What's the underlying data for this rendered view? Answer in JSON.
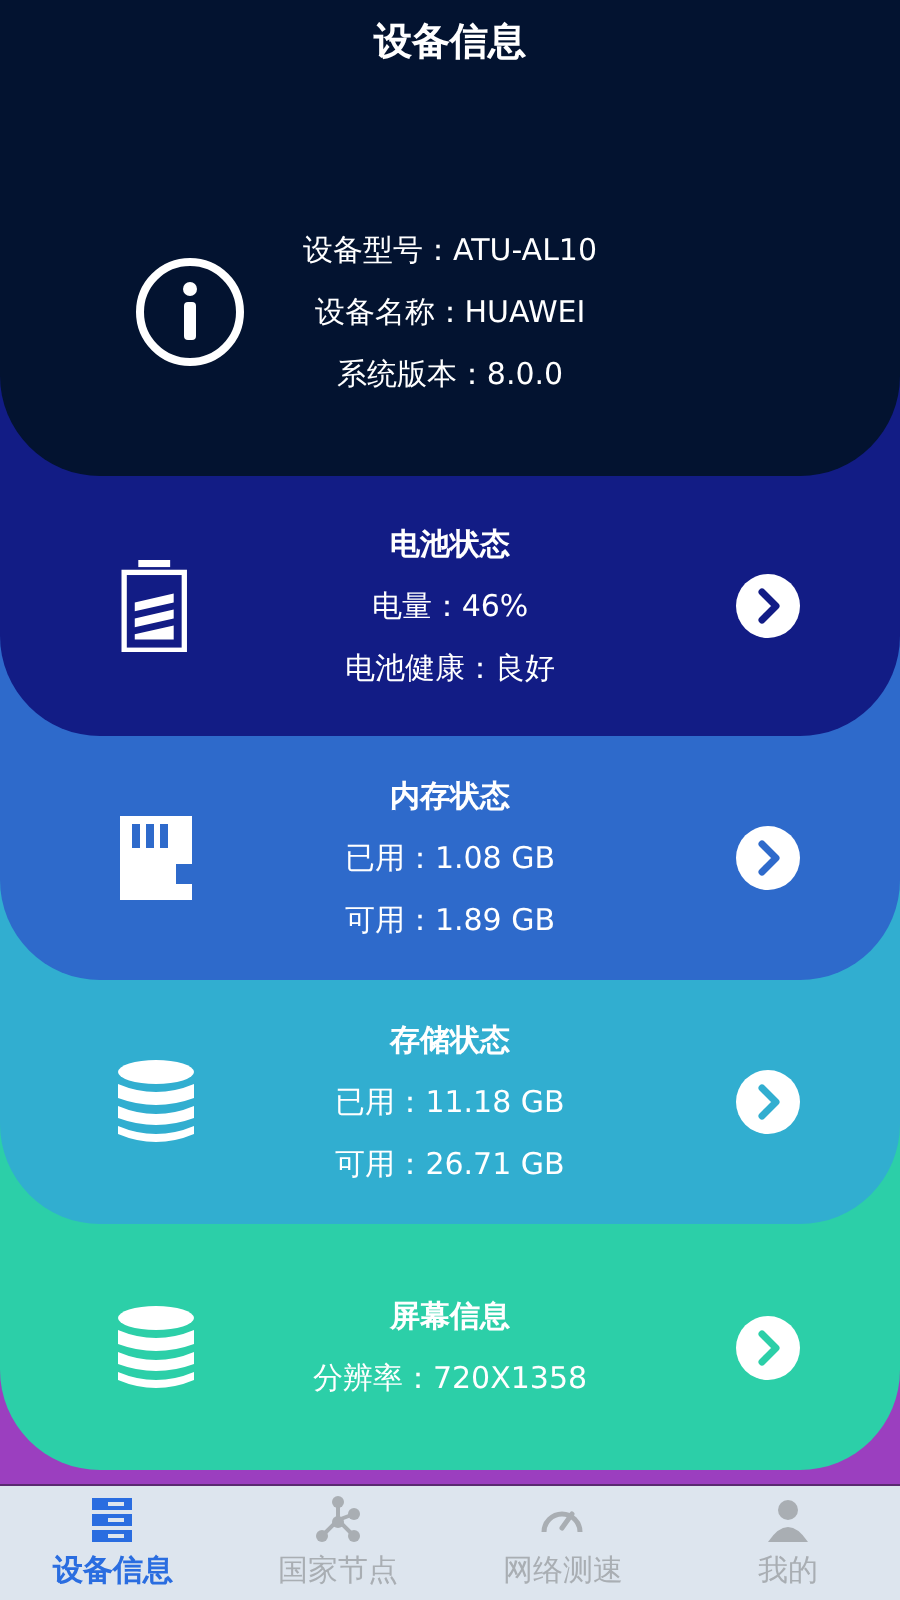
{
  "header": {
    "title": "设备信息",
    "lines": [
      "设备型号：ATU-AL10",
      "设备名称：HUAWEI",
      "系统版本：8.0.0"
    ]
  },
  "cards": [
    {
      "kind": "battery",
      "color": "#121c85",
      "title": "电池状态",
      "lines": [
        "电量：46%",
        "电池健康：良好"
      ]
    },
    {
      "kind": "memory",
      "color": "#2e6acb",
      "title": "内存状态",
      "lines": [
        "已用：1.08 GB",
        "可用：1.89 GB"
      ]
    },
    {
      "kind": "storage",
      "color": "#31aed0",
      "title": "存储状态",
      "lines": [
        "已用：11.18 GB",
        "可用：26.71 GB"
      ]
    },
    {
      "kind": "screen",
      "color": "#2ccfa8",
      "title": "屏幕信息",
      "lines": [
        "分辨率：720X1358"
      ]
    }
  ],
  "tabs": [
    {
      "kind": "device",
      "label": "设备信息",
      "selected": true
    },
    {
      "kind": "nodes",
      "label": "国家节点",
      "selected": false
    },
    {
      "kind": "speed",
      "label": "网络测速",
      "selected": false
    },
    {
      "kind": "me",
      "label": "我的",
      "selected": false
    }
  ]
}
